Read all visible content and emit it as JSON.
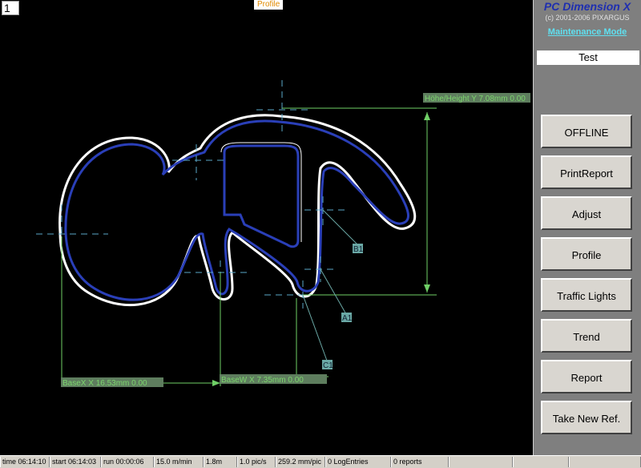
{
  "viewport": {
    "number": "1",
    "title": "Profile"
  },
  "measurements": {
    "height": "Höhe/Height Y 7.08mm 0.00",
    "width_x": "BaseX   X 16.53mm 0.00",
    "width_w": "BaseW   X 7.35mm 0.00"
  },
  "markers": [
    "B1",
    "A1",
    "C1"
  ],
  "sidebar": {
    "app_title": "PC Dimension X",
    "copyright": "(c) 2001-2006 PIXARGUS",
    "maintenance_link": "Maintenance Mode",
    "mode_value": "Test",
    "buttons": [
      "OFFLINE",
      "PrintReport",
      "Adjust",
      "Profile",
      "Traffic Lights",
      "Trend",
      "Report",
      "Take New Ref."
    ]
  },
  "statusbar": {
    "time": "time 06:14:10",
    "start": "start 06:14:03",
    "run": "run 00:00:06",
    "speed": "15.0 m/min",
    "length": "1.8m",
    "pic_rate": "1.0 pic/s",
    "mm_per_pic": "259.2 mm/pic",
    "log_entries": "0 LogEntries",
    "reports": "0 reports"
  },
  "colors": {
    "outline": "#ffffff",
    "profile": "#2a3fb8",
    "measurement": "#6fcf66",
    "marker": "#6aa8a5"
  }
}
